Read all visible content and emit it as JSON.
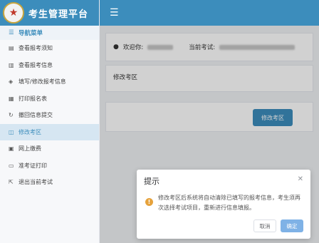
{
  "app": {
    "title": "考生管理平台"
  },
  "sidebar": {
    "header": "导航菜单",
    "items": [
      {
        "label": "查看报考须知",
        "icon": "document-icon"
      },
      {
        "label": "查看报考信息",
        "icon": "file-list-icon"
      },
      {
        "label": "填写/修改报考信息",
        "icon": "shield-check-icon"
      },
      {
        "label": "打印报名表",
        "icon": "printer-icon"
      },
      {
        "label": "撤回信息提交",
        "icon": "undo-icon"
      },
      {
        "label": "修改考区",
        "icon": "map-icon",
        "active": true
      },
      {
        "label": "网上缴费",
        "icon": "payment-icon"
      },
      {
        "label": "准考证打印",
        "icon": "id-card-icon"
      },
      {
        "label": "退出当前考试",
        "icon": "exit-icon"
      }
    ]
  },
  "header": {
    "welcome_label": "欢迎你:",
    "current_exam_label": "当前考试:"
  },
  "region": {
    "label": "修改考区",
    "button": "修改考区"
  },
  "dialog": {
    "title": "提示",
    "message": "修改考区后系统将自动清除已填写的报考信息，考生须再次选择考试项目，重新进行信息填报。",
    "cancel": "取消",
    "confirm": "确定"
  },
  "colors": {
    "primary": "#3c8dbc",
    "warning": "#e6a23c",
    "confirm_disabled": "#7fb2e6"
  }
}
